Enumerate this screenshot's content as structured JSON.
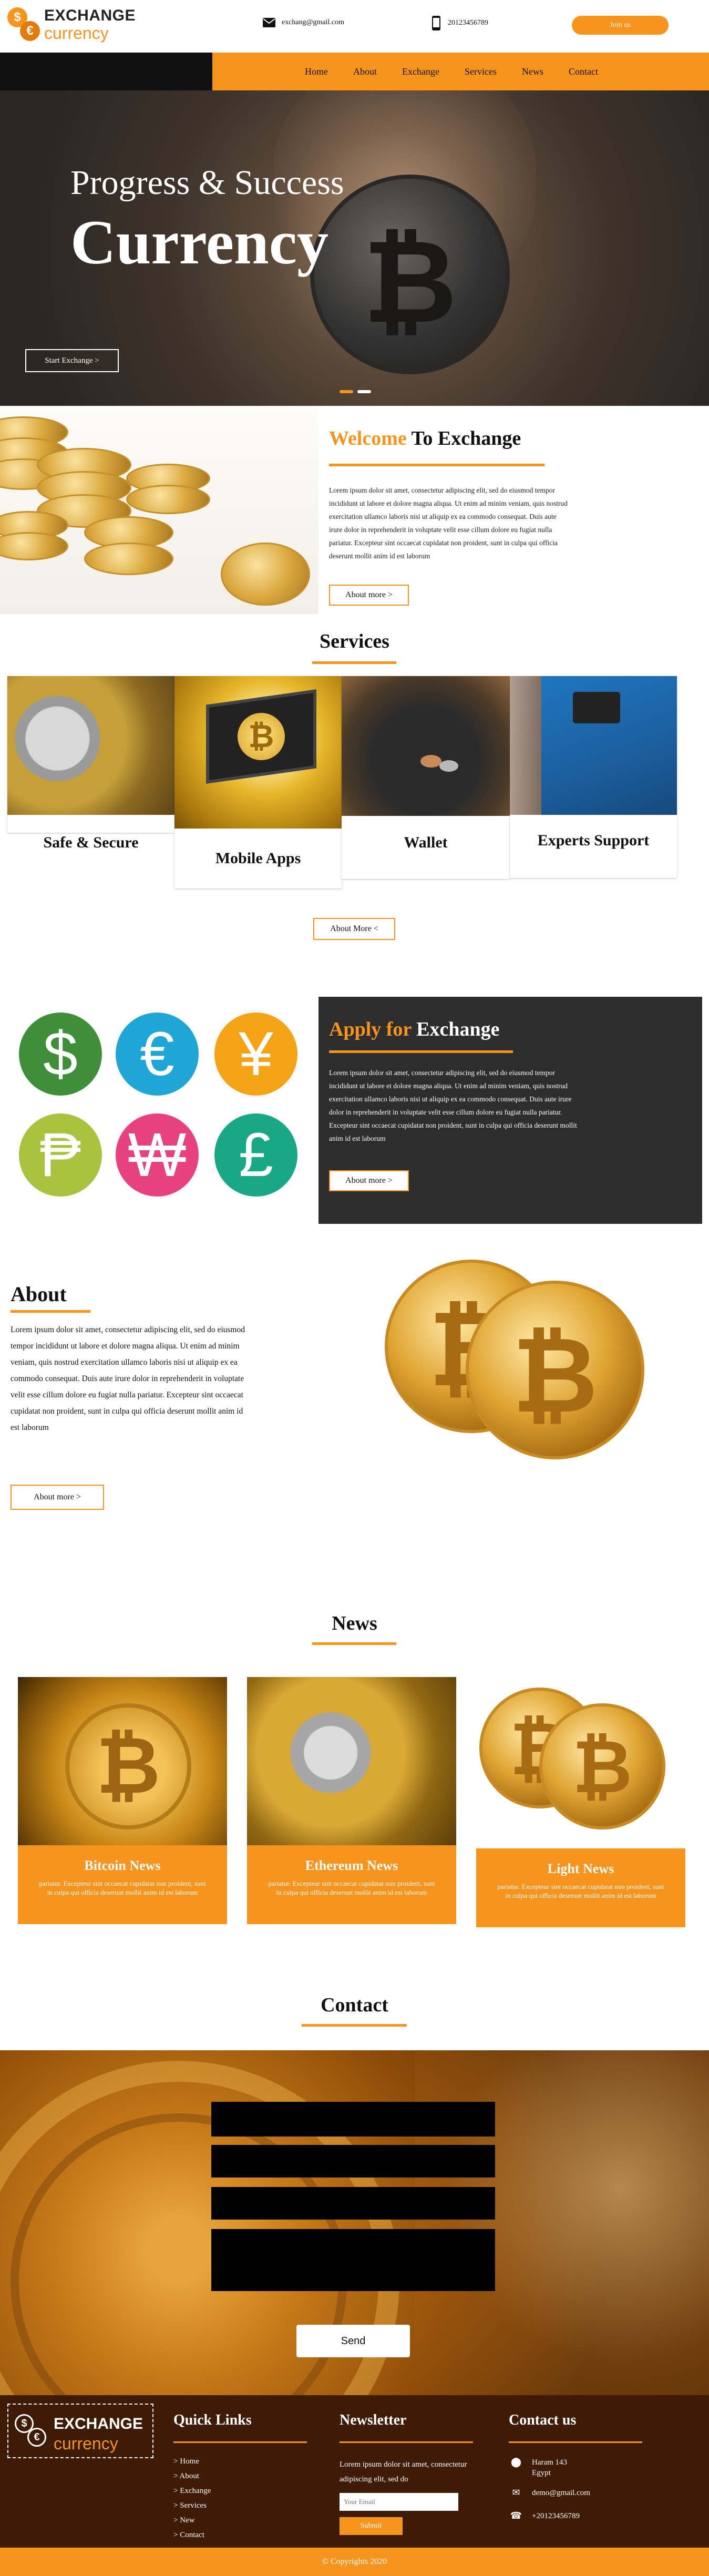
{
  "header": {
    "logo_line1": "EXCHANGE",
    "logo_line2": "currency",
    "email": "exchang@gmail.com",
    "phone": "20123456789",
    "join_label": "Join us"
  },
  "nav": [
    "Home",
    "About",
    "Exchange",
    "Services",
    "News",
    "Contact"
  ],
  "hero": {
    "subtitle": "Progress & Success",
    "title": "Currency",
    "button": "Start Exchange >"
  },
  "welcome": {
    "title_accent": "Welcome",
    "title_rest": " To Exchange",
    "body": "Lorem ipsum dolor sit amet, consectetur adipiscing elit, sed do eiusmod tempor incididunt ut labore et dolore magna aliqua. Ut enim ad minim veniam, quis nostrud exercitation ullamco laboris nisi ut aliquip ex ea commodo consequat. Duis aute irure dolor in reprehenderit in voluptate velit esse cillum dolore eu fugiat nulla pariatur. Excepteur sint occaecat cupidatat non proident, sunt in culpa qui officia deserunt mollit anim id est laborum",
    "button": "About more >"
  },
  "services": {
    "title": "Services",
    "cards": [
      "Safe & Secure",
      "Mobile Apps",
      "Wallet",
      "Experts Support"
    ],
    "button": "About More <"
  },
  "apply": {
    "symbols": [
      "$",
      "€",
      "¥",
      "₱",
      "₩",
      "£"
    ],
    "colors": [
      "#3f8f3a",
      "#1fa6d6",
      "#f4a316",
      "#a9c23f",
      "#e8417f",
      "#18a886"
    ],
    "title_accent": "Apply for",
    "title_rest": " Exchange",
    "body": "Lorem ipsum dolor sit amet, consectetur adipiscing elit, sed do eiusmod tempor incididunt ut labore et dolore magna aliqua. Ut enim ad minim veniam, quis nostrud exercitation ullamco laboris nisi ut aliquip ex ea commodo consequat. Duis aute irure dolor in reprehenderit in voluptate velit esse cillum dolore eu fugiat nulla pariatur. Excepteur sint occaecat cupidatat non proident, sunt in culpa qui officia deserunt mollit anim id est laborum",
    "button": "About more >"
  },
  "about": {
    "title": "About",
    "body": "Lorem ipsum dolor sit amet, consectetur adipiscing elit, sed do eiusmod tempor incididunt ut labore et dolore magna aliqua. Ut enim ad minim veniam, quis nostrud exercitation ullamco laboris nisi ut aliquip ex ea commodo consequat. Duis aute irure dolor in reprehenderit in voluptate velit esse cillum dolore eu fugiat nulla pariatur. Excepteur sint occaecat cupidatat non proident, sunt in culpa qui officia deserunt mollit anim id est laborum",
    "button": "About more >"
  },
  "news": {
    "title": "News",
    "items": [
      {
        "title": "Bitcoin News",
        "text": "pariatur. Excepteur sint occaecat cupidatat non proident, sunt in culpa qui officia deserunt mollit anim id est laborum"
      },
      {
        "title": "Ethereum News",
        "text": "pariatur. Excepteur sint occaecat cupidatat non proident, sunt in culpa qui officia deserunt mollit anim id est laborum"
      },
      {
        "title": "Light News",
        "text": "pariatur. Excepteur sint occaecat cupidatat non proident, sunt in culpa qui officia deserunt mollit anim id est laborum"
      }
    ]
  },
  "contact": {
    "title": "Contact",
    "send": "Send"
  },
  "footer": {
    "logo_line1": "EXCHANGE",
    "logo_line2": "currency",
    "quick_title": "Quick Links",
    "links": [
      "> Home",
      "> About",
      "> Exchange",
      "> Services",
      "> New",
      "> Contact"
    ],
    "newsletter_title": "Newsletter",
    "newsletter_text": "Lorem ipsum dolor sit amet, consectetur adipiscing elit, sed do",
    "email_placeholder": "Your Email",
    "submit": "Submit",
    "contact_title": "Contact us",
    "address_line1": "Haram 143",
    "address_line2": "Egypt",
    "email": "demo@gmail.com",
    "phone": "+20123456789",
    "copyright": "© Copyrights 2020"
  },
  "colors": {
    "accent": "#f7941d",
    "dark": "#2d2d2d",
    "footer": "#3e1b04"
  }
}
